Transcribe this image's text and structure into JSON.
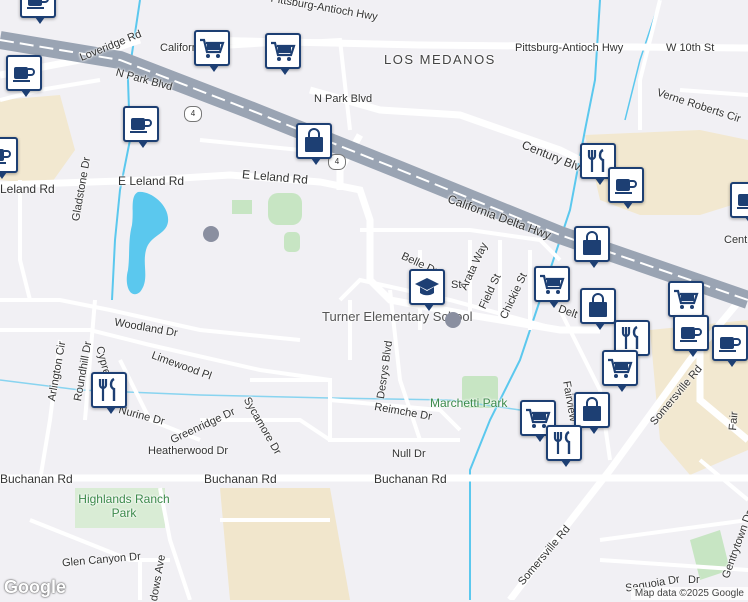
{
  "map": {
    "area_labels": {
      "los_medanos": "LOS MEDANOS"
    },
    "road_labels": {
      "pittsburg_antioch_hwy_top": "Pittsburg-Antioch Hwy",
      "pittsburg_antioch_hwy": "Pittsburg-Antioch Hwy",
      "w_10th_st": "W 10th St",
      "loveridge_rd": "Loveridge Rd",
      "california_top": "Californ",
      "n_park_blvd_1": "N Park Blvd",
      "n_park_blvd_2": "N Park Blvd",
      "verne_roberts_cir": "Verne Roberts Cir",
      "century_blvd": "Century Blvd",
      "e_leland_rd_1": "E Leland Rd",
      "e_leland_rd_2": "E Leland Rd",
      "leland_rd": "Leland Rd",
      "gladstone_dr": "Gladstone Dr",
      "california_delta_hwy": "California Delta Hwy",
      "centre": "Cent",
      "belle_dr": "Belle Dr",
      "arata_way": "Arata Way",
      "field_st": "Field St",
      "chickie_st": "Chickie St",
      "st": "St",
      "delta": "Delt",
      "fairview_dr": "Fairview Dr",
      "somersville_rd_1": "Somersville Rd",
      "somersville_rd_2": "Somersville Rd",
      "fair_blvd": "Fair",
      "woodland_dr": "Woodland Dr",
      "arlington_cir": "Arlington Cir",
      "cypress": "Cypres",
      "roundhill_dr": "Roundhill Dr",
      "limewood_pl": "Limewood Pl",
      "desrys_blvd": "Desrys Blvd",
      "nurine_dr": "Nurine Dr",
      "greenridge_dr": "Greenridge Dr",
      "sycamore_dr": "Sycamore Dr",
      "reimche_dr": "Reimche Dr",
      "heatherwood_dr": "Heatherwood Dr",
      "null_dr": "Null Dr",
      "buchanan_rd_1": "Buchanan Rd",
      "buchanan_rd_2": "Buchanan Rd",
      "buchanan_rd_3": "Buchanan Rd",
      "glen_canyon_dr": "Glen Canyon Dr",
      "meadows_ave": "dows Ave",
      "gentrytown_dr": "Gentrytown Dr",
      "sequoia_dr": "Sequoia Dr",
      "dr_bottom": "Dr"
    },
    "highway_shield": "4",
    "pois": {
      "turner_school": "Turner Elementary School",
      "marchetti_park": "Marchetti Park",
      "highlands_ranch_park": "Highlands Ranch Park"
    },
    "colors": {
      "background": "#f1f0f4",
      "park": "#c7e5c3",
      "freeway": "#9aa4b3",
      "water": "#5bc8ee",
      "commercial": "#f2e8d0",
      "pin_border": "#1d3f73"
    },
    "markers": [
      {
        "icon": "coffee-icon"
      },
      {
        "icon": "coffee-icon"
      },
      {
        "icon": "shopping-cart-icon"
      },
      {
        "icon": "shopping-cart-icon"
      },
      {
        "icon": "coffee-icon"
      },
      {
        "icon": "coffee-icon"
      },
      {
        "icon": "shopping-bag-icon"
      },
      {
        "icon": "restaurant-icon"
      },
      {
        "icon": "coffee-icon"
      },
      {
        "icon": "coffee-icon"
      },
      {
        "icon": "school-icon"
      },
      {
        "icon": "shopping-cart-icon"
      },
      {
        "icon": "shopping-bag-icon"
      },
      {
        "icon": "shopping-bag-icon"
      },
      {
        "icon": "shopping-cart-icon"
      },
      {
        "icon": "restaurant-icon"
      },
      {
        "icon": "coffee-icon"
      },
      {
        "icon": "coffee-icon"
      },
      {
        "icon": "shopping-cart-icon"
      },
      {
        "icon": "restaurant-icon"
      },
      {
        "icon": "shopping-bag-icon"
      },
      {
        "icon": "shopping-cart-icon"
      },
      {
        "icon": "restaurant-icon"
      }
    ],
    "branding": "Google",
    "attribution": "Map data ©2025 Google"
  }
}
